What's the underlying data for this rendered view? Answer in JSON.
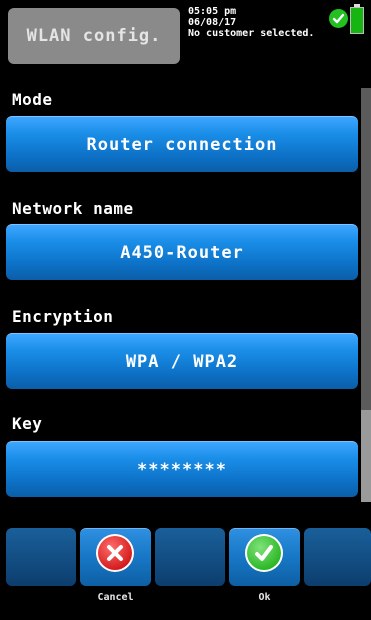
{
  "header": {
    "title": "WLAN config.",
    "time": "05:05 pm",
    "date": "06/08/17",
    "customer_status": "No customer selected."
  },
  "sections": [
    {
      "label": "Mode",
      "value": "Router connection"
    },
    {
      "label": "Network name",
      "value": "A450-Router"
    },
    {
      "label": "Encryption",
      "value": "WPA / WPA2"
    },
    {
      "label": "Key",
      "value": "********"
    }
  ],
  "softkeys": {
    "cancel": "Cancel",
    "ok": "Ok"
  },
  "colors": {
    "button_blue": "#1a8ee8",
    "status_ok": "#22c020",
    "cancel_red": "#d21818"
  },
  "icons": [
    "check-circle-icon",
    "battery-icon",
    "cancel-icon",
    "ok-check-icon"
  ]
}
